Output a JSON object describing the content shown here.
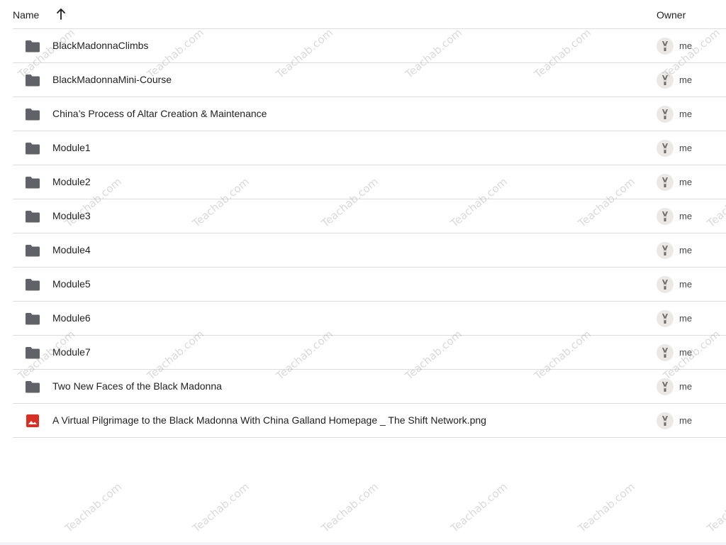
{
  "header": {
    "name_label": "Name",
    "owner_label": "Owner",
    "sort_icon": "arrow-up-icon"
  },
  "rows": [
    {
      "type": "folder",
      "icon": "folder-icon",
      "name": "BlackMadonnaClimbs",
      "owner": "me"
    },
    {
      "type": "folder",
      "icon": "folder-icon",
      "name": "BlackMadonnaMini-Course",
      "owner": "me"
    },
    {
      "type": "folder",
      "icon": "folder-icon",
      "name": "China’s Process of Altar Creation & Maintenance",
      "owner": "me"
    },
    {
      "type": "folder",
      "icon": "folder-icon",
      "name": "Module1",
      "owner": "me"
    },
    {
      "type": "folder",
      "icon": "folder-icon",
      "name": "Module2",
      "owner": "me"
    },
    {
      "type": "folder",
      "icon": "folder-icon",
      "name": "Module3",
      "owner": "me"
    },
    {
      "type": "folder",
      "icon": "folder-icon",
      "name": "Module4",
      "owner": "me"
    },
    {
      "type": "folder",
      "icon": "folder-icon",
      "name": "Module5",
      "owner": "me"
    },
    {
      "type": "folder",
      "icon": "folder-icon",
      "name": "Module6",
      "owner": "me"
    },
    {
      "type": "folder",
      "icon": "folder-icon",
      "name": "Module7",
      "owner": "me"
    },
    {
      "type": "folder",
      "icon": "folder-icon",
      "name": "Two New Faces of the Black Madonna",
      "owner": "me"
    },
    {
      "type": "image",
      "icon": "image-file-icon",
      "name": "A Virtual Pilgrimage to the Black Madonna With China Galland Homepage _ The Shift Network.png",
      "owner": "me"
    }
  ],
  "watermark": "Teachab.com",
  "colors": {
    "folder": "#5f6368",
    "image_file": "#d93025",
    "divider": "#dadce0",
    "avatar_bg": "#ece9e4"
  }
}
